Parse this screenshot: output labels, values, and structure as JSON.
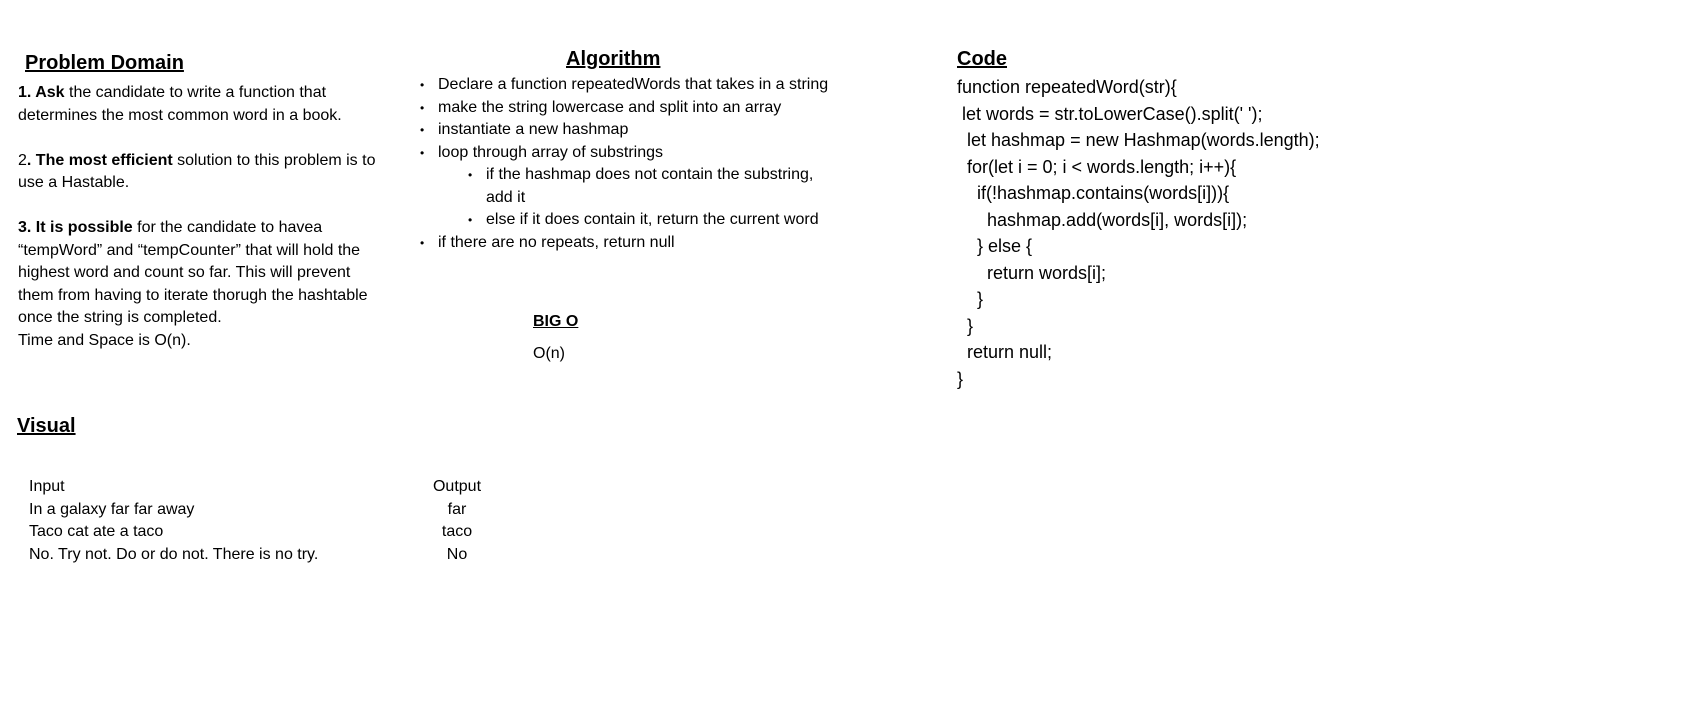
{
  "problem_domain": {
    "title": "Problem Domain",
    "p1_bold": "1. Ask",
    "p1_rest": " the candidate to write a function that",
    "p1_line2": "determines the most common word in a book.",
    "p2_prefix": "2",
    "p2_bold": ". The most efficient",
    "p2_rest": " solution to this problem is to",
    "p2_line2": "use a Hastable.",
    "p3_bold": "3. It is possible",
    "p3_rest": " for the candidate to havea",
    "p3_line2": "“tempWord” and “tempCounter” that will hold the",
    "p3_line3": "highest word and count so far. This will prevent",
    "p3_line4": "them from having to iterate thorugh the hashtable",
    "p3_line5": "once the string is completed.",
    "p4": "Time and Space is O(n)."
  },
  "algorithm": {
    "title": "Algorithm",
    "bullet_char": "•",
    "items": [
      "Declare a function repeatedWords that takes in a string",
      "make the string lowercase and split into an array",
      "instantiate a new hashmap",
      "loop through array of substrings"
    ],
    "sub_items": [
      "if the hashmap does not contain the substring,",
      "add it",
      "else if it does contain it, return the current word"
    ],
    "last_item": "if there are no repeats, return null"
  },
  "big_o": {
    "title": "BIG O",
    "value": "O(n)"
  },
  "code": {
    "title": "Code",
    "lines": [
      "function repeatedWord(str){",
      " let words = str.toLowerCase().split(' ');",
      "  let hashmap = new Hashmap(words.length);",
      "  for(let i = 0; i < words.length; i++){",
      "    if(!hashmap.contains(words[i])){",
      "      hashmap.add(words[i], words[i]);",
      "    } else {",
      "      return words[i];",
      "    }",
      "  }",
      "  return null;",
      "}"
    ]
  },
  "visual": {
    "title": "Visual",
    "header_input": "Input",
    "header_output": "Output",
    "rows": [
      {
        "input": "In a galaxy far far away",
        "output": "far"
      },
      {
        "input": "Taco cat ate a taco",
        "output": "taco"
      },
      {
        "input": "No. Try not. Do or do not. There is no try.",
        "output": "No"
      }
    ]
  }
}
